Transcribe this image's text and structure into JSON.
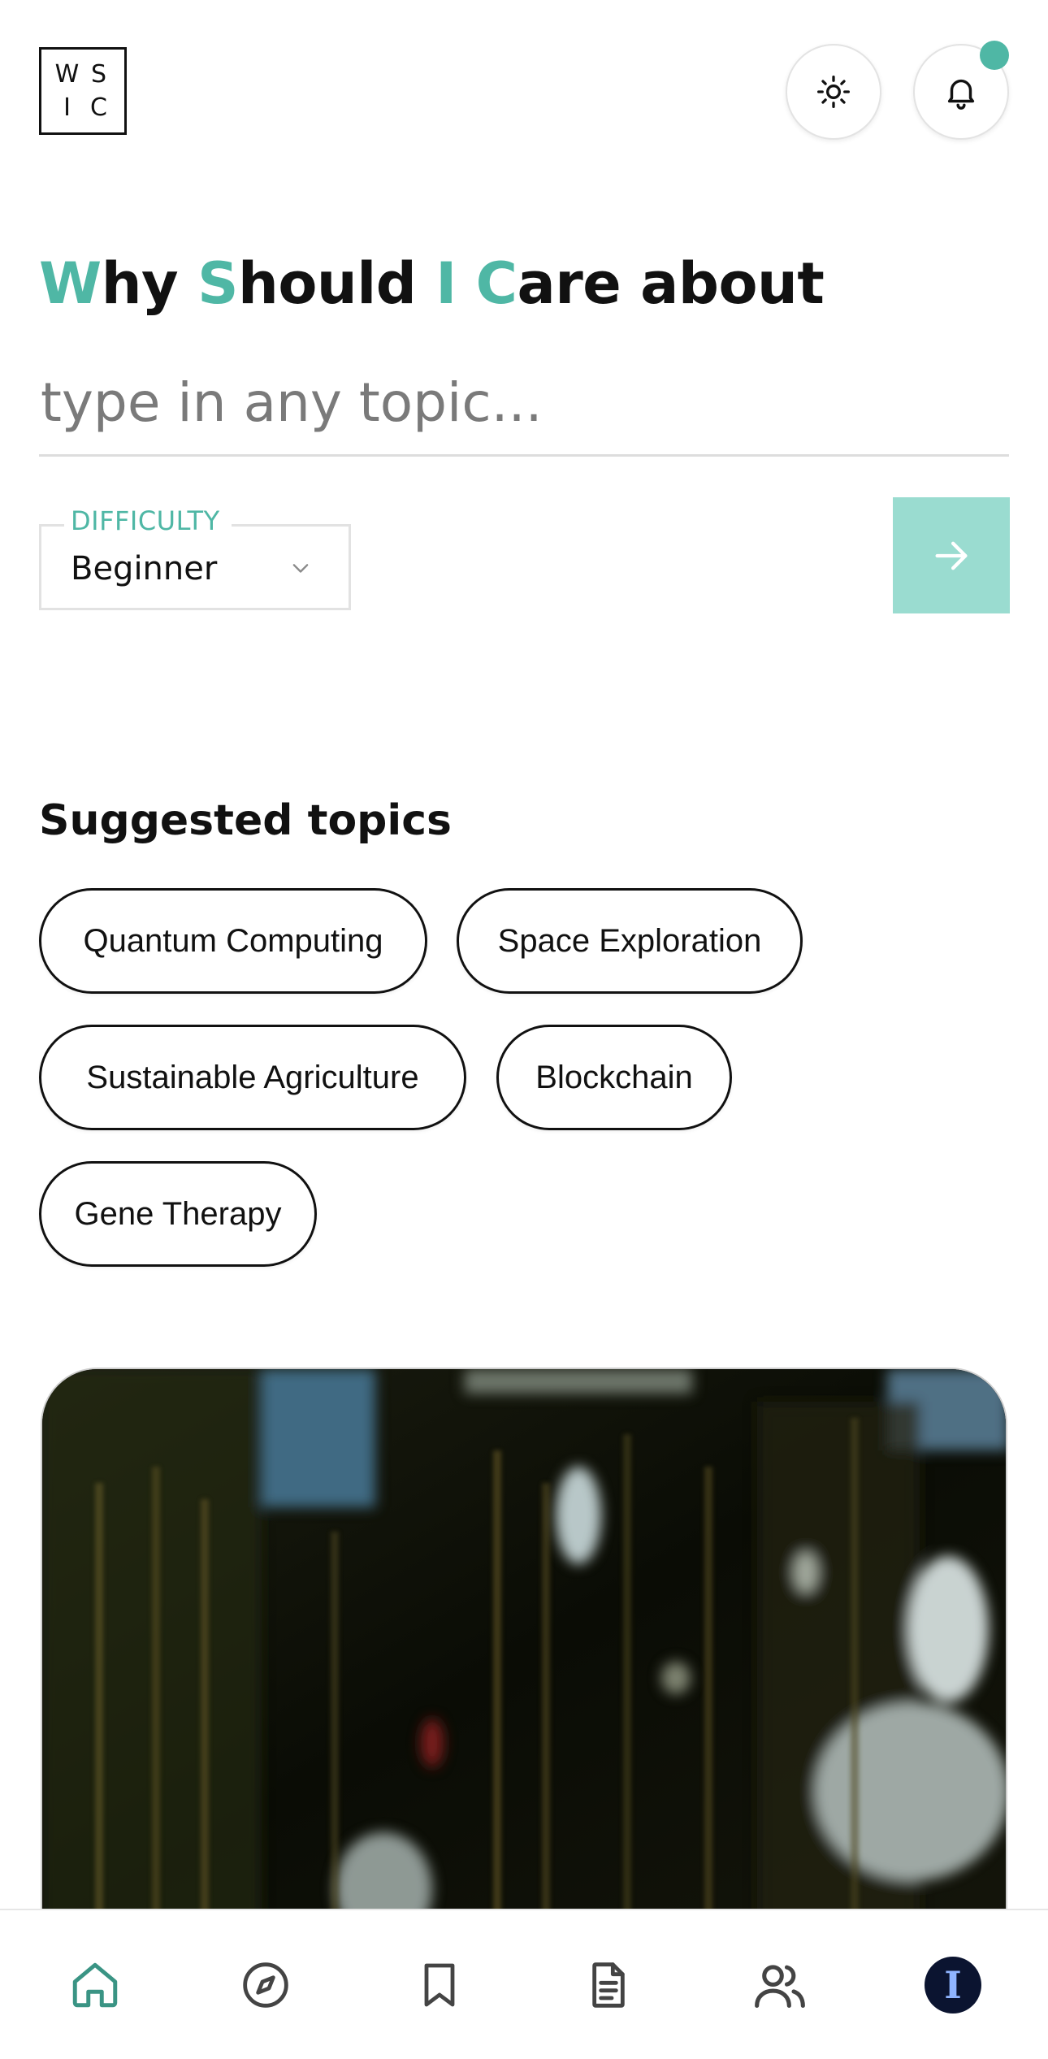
{
  "header": {
    "logo_letters": [
      "W",
      "S",
      "I",
      "C"
    ],
    "notification_dot_color": "#4fb7a5"
  },
  "hero": {
    "headline_parts": [
      "W",
      "hy ",
      "S",
      "hould ",
      "I",
      " ",
      "C",
      "are about"
    ],
    "accent_color": "#4fb7a5",
    "topic_placeholder": "type in any topic...",
    "topic_value": ""
  },
  "difficulty": {
    "label": "DIFFICULTY",
    "selected": "Beginner"
  },
  "suggested": {
    "title": "Suggested topics",
    "topics": [
      "Quantum Computing",
      "Space Exploration",
      "Sustainable Agriculture",
      "Blockchain",
      "Gene Therapy"
    ]
  },
  "bottom_nav": {
    "items": [
      "home-icon",
      "compass-icon",
      "bookmark-icon",
      "document-icon",
      "users-icon",
      "profile-avatar"
    ],
    "active": "home-icon",
    "avatar_letter": "I"
  }
}
